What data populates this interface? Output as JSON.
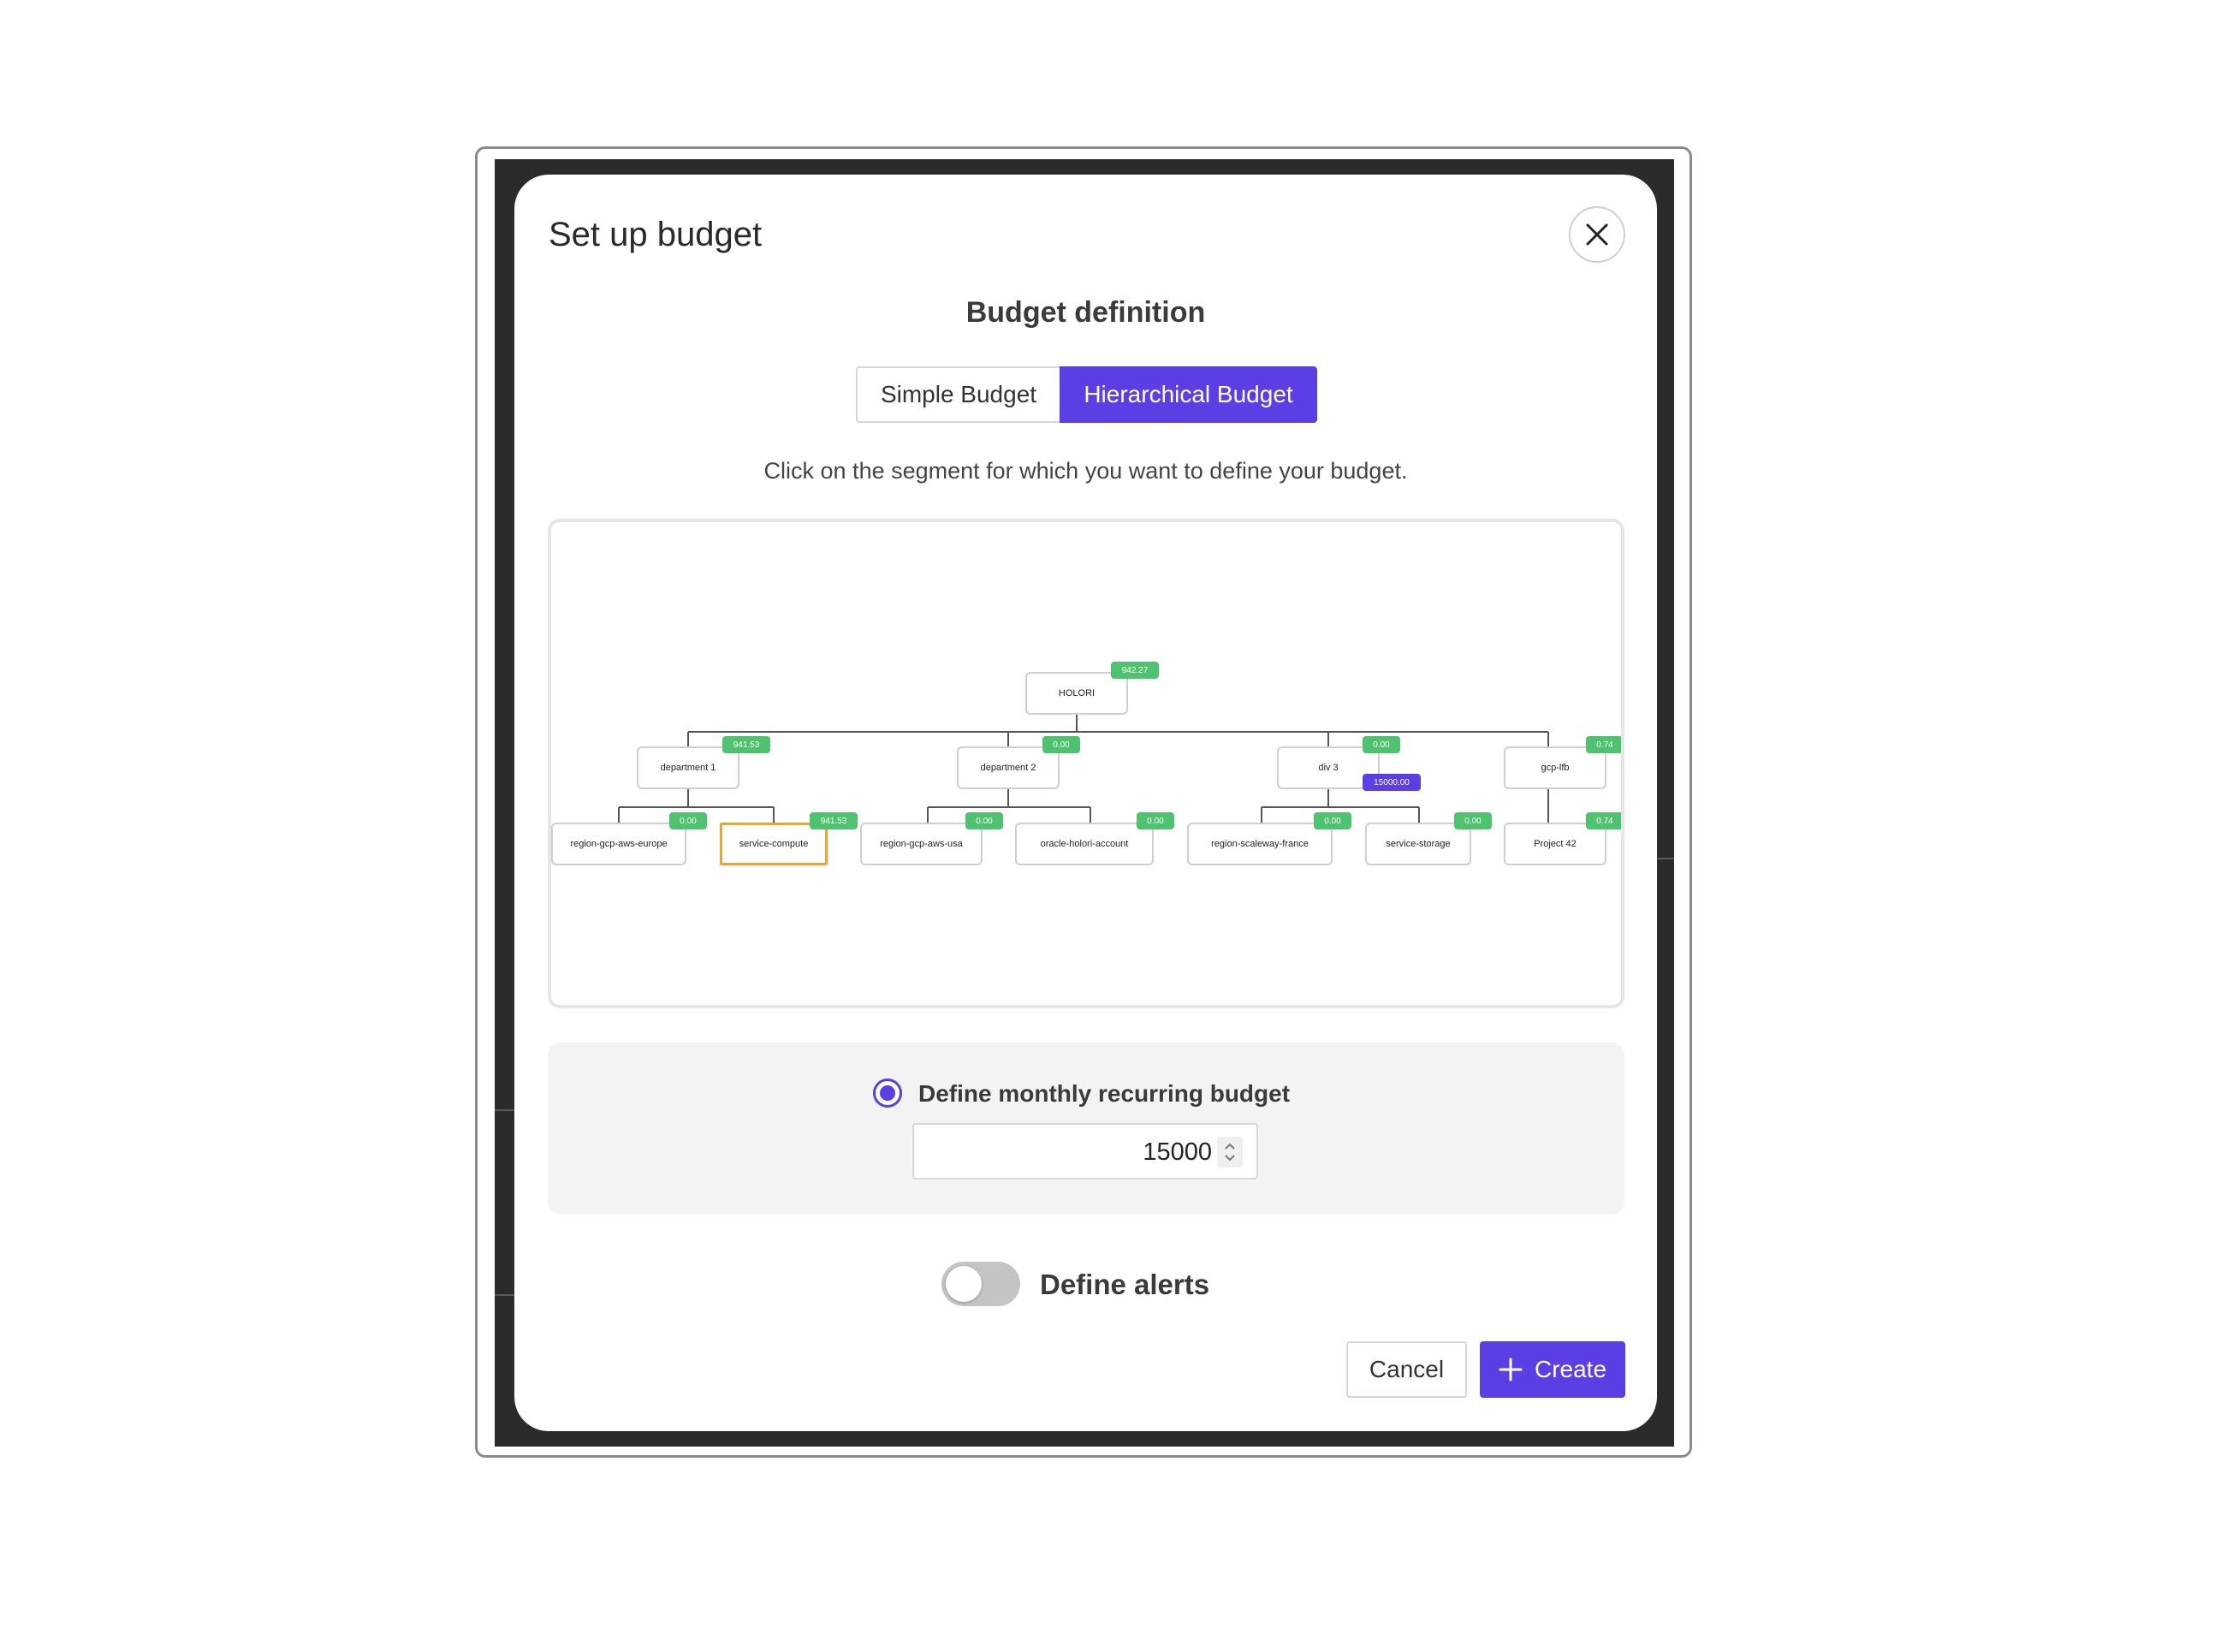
{
  "modal": {
    "title": "Set up budget",
    "section_title": "Budget definition",
    "tabs": [
      {
        "label": "Simple Budget",
        "active": false
      },
      {
        "label": "Hierarchical Budget",
        "active": true
      }
    ],
    "instruction": "Click on the segment for which you want to define your budget."
  },
  "tree": {
    "nodes": [
      {
        "label": "HOLORI",
        "badge": "942.27"
      },
      {
        "label": "department 1",
        "badge": "941.53"
      },
      {
        "label": "department 2",
        "badge": "0.00"
      },
      {
        "label": "div 3",
        "badge": "0.00",
        "budget_badge": "15000.00"
      },
      {
        "label": "gcp-lfb",
        "badge": "0.74"
      },
      {
        "label": "region-gcp-aws-europe",
        "badge": "0.00"
      },
      {
        "label": "service-compute",
        "badge": "941.53",
        "selected": true
      },
      {
        "label": "region-gcp-aws-usa",
        "badge": "0.00"
      },
      {
        "label": "oracle-holori-account",
        "badge": "0.00"
      },
      {
        "label": "region-scaleway-france",
        "badge": "0.00"
      },
      {
        "label": "service-storage",
        "badge": "0.00"
      },
      {
        "label": "Project 42",
        "badge": "0.74"
      }
    ]
  },
  "budget": {
    "radio_label": "Define monthly recurring budget",
    "radio_selected": true,
    "amount": "15000"
  },
  "alerts": {
    "label": "Define alerts",
    "enabled": false
  },
  "actions": {
    "cancel_label": "Cancel",
    "create_label": "Create"
  },
  "colors": {
    "accent": "#5b3fe4",
    "badge_green": "#4fc26f",
    "selected_outline": "#f0a232"
  }
}
